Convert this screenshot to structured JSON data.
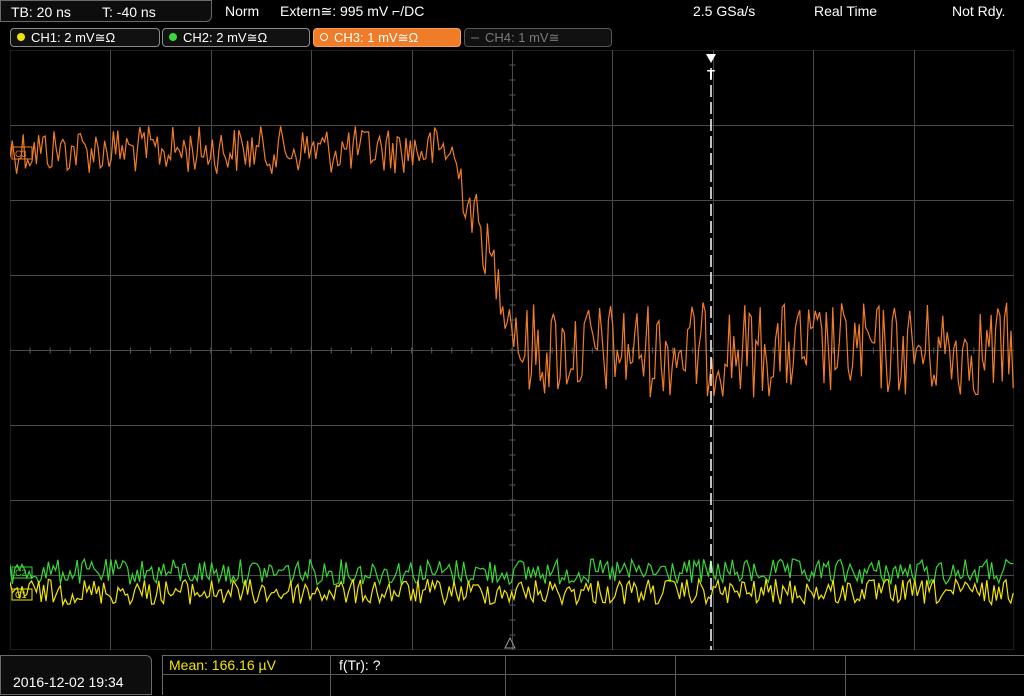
{
  "header": {
    "timebase": "TB: 20 ns",
    "trigger_time": "T: -40 ns",
    "mode": "Norm",
    "trigger_source": "Extern≅: 995 mV ⌐/DC",
    "sample_rate": "2.5 GSa/s",
    "acq_mode": "Real Time",
    "status": "Not Rdy."
  },
  "channels": [
    {
      "label": "CH1: 2 mV≅Ω",
      "color": "#f2e600",
      "state": "on"
    },
    {
      "label": "CH2: 2 mV≅Ω",
      "color": "#38d838",
      "state": "on"
    },
    {
      "label": "CH3: 1 mV≅Ω",
      "color": "#f07c28",
      "state": "active"
    },
    {
      "label": "CH4: 1 mV≅",
      "color": "#606060",
      "state": "off"
    }
  ],
  "markers": {
    "ch3": "C3",
    "ch2": "C2",
    "ch1": "C1",
    "trigger": "T"
  },
  "footer": {
    "datetime": "2016-12-02 19:34",
    "meas1": "Mean: 166.16 µV",
    "meas2": "f(Tr): ?"
  },
  "colors": {
    "ch1": "#f2e600",
    "ch2": "#38d838",
    "ch3": "#f07c28",
    "grid": "#4a4a4a",
    "meas_highlight": "#f2e600"
  }
}
